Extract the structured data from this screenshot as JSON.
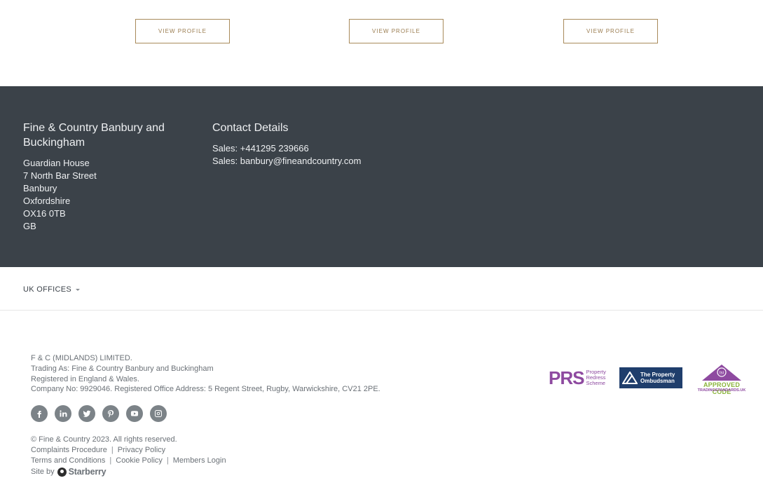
{
  "profiles": {
    "buttons": [
      "VIEW PROFILE",
      "VIEW PROFILE",
      "VIEW PROFILE"
    ]
  },
  "office": {
    "name": "Fine & Country Banbury and Buckingham",
    "address": [
      "Guardian House",
      "7 North Bar Street",
      "Banbury",
      "Oxfordshire",
      "OX16 0TB",
      "GB"
    ]
  },
  "contact": {
    "title": "Contact Details",
    "lines": [
      "Sales: +441295 239666",
      "Sales: banbury@fineandcountry.com"
    ]
  },
  "offices_menu": {
    "label": "UK OFFICES"
  },
  "legal": {
    "lines": [
      "F & C (MIDLANDS) LIMITED.",
      "Trading As: Fine & Country Banbury and Buckingham",
      "Registered in England & Wales.",
      "Company No: 9929046. Registered Office Address: 5 Regent Street, Rugby, Warwickshire, CV21 2PE."
    ]
  },
  "social": {
    "icons": [
      "facebook-icon",
      "linkedin-icon",
      "twitter-icon",
      "pinterest-icon",
      "youtube-icon",
      "instagram-icon"
    ]
  },
  "footer_links": {
    "copyright": "© Fine & Country 2023. All rights reserved.",
    "complaints": "Complaints Procedure",
    "privacy": "Privacy Policy",
    "terms": "Terms and Conditions",
    "cookie": "Cookie Policy",
    "members": "Members Login",
    "site_by": "Site by",
    "starberry": "Starberry"
  },
  "badges": {
    "prs_mark": "PRS",
    "prs_text": [
      "Property",
      "Redress",
      "Scheme"
    ],
    "ombudsman": [
      "The Property",
      "Ombudsman"
    ],
    "tsi_label": "tsi",
    "tsi_code": "APPROVED CODE",
    "tsi_sub": "TRADINGSTANDARDS.UK"
  },
  "colors": {
    "dark_band": "#3b4249",
    "gold": "#a88a5a",
    "prs_purple": "#8e4aa0",
    "ombudsman_blue": "#1f3e6c",
    "tsi_green": "#8ab43a"
  }
}
